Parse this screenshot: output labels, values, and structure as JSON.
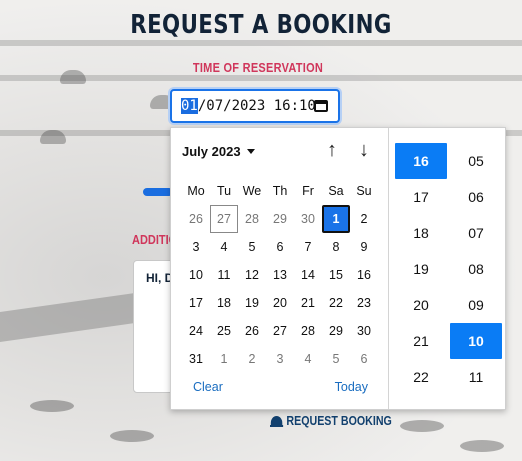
{
  "page": {
    "title": "REQUEST A BOOKING",
    "time_label": "TIME OF RESERVATION",
    "additional_label": "ADDITIO",
    "textarea_value": "HI, DO",
    "submit_label": "REQUEST BOOKING"
  },
  "datetime": {
    "selected_segment": "01",
    "rest": "/07/2023 16:10"
  },
  "calendar": {
    "month_label": "July 2023",
    "weekdays": [
      "Mo",
      "Tu",
      "We",
      "Th",
      "Fr",
      "Sa",
      "Su"
    ],
    "weeks": [
      [
        "26",
        "27",
        "28",
        "29",
        "30",
        "1",
        "2"
      ],
      [
        "3",
        "4",
        "5",
        "6",
        "7",
        "8",
        "9"
      ],
      [
        "10",
        "11",
        "12",
        "13",
        "14",
        "15",
        "16"
      ],
      [
        "17",
        "18",
        "19",
        "20",
        "21",
        "22",
        "23"
      ],
      [
        "24",
        "25",
        "26",
        "27",
        "28",
        "29",
        "30"
      ],
      [
        "31",
        "1",
        "2",
        "3",
        "4",
        "5",
        "6"
      ]
    ],
    "clear_label": "Clear",
    "today_label": "Today",
    "up_arrow": "↑",
    "down_arrow": "↓"
  },
  "time": {
    "hours": [
      "16",
      "17",
      "18",
      "19",
      "20",
      "21",
      "22"
    ],
    "minutes": [
      "05",
      "06",
      "07",
      "08",
      "09",
      "10",
      "11"
    ],
    "selected_hour": "16",
    "selected_minute": "10"
  },
  "colors": {
    "accent": "#1a73e8",
    "title": "#122337",
    "label": "#d0365b"
  }
}
